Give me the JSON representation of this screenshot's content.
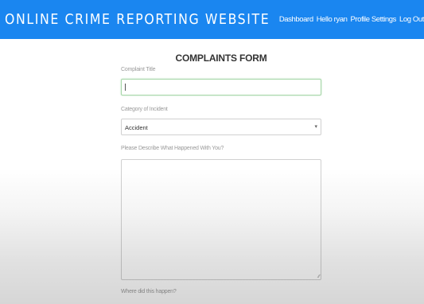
{
  "navbar": {
    "brand": "ONLINE CRIME REPORTING WEBSITE",
    "links": [
      "Dashboard",
      "Hello ryan",
      "Profile Settings",
      "Log Out"
    ],
    "background_color": "#1a86f0"
  },
  "form": {
    "title": "COMPLAINTS FORM",
    "complaint_title_label": "Complaint Title",
    "complaint_title_value": "",
    "category_label": "Category of Incident",
    "category_value": "Accident",
    "description_label": "Please Describe What Happened With You?",
    "description_value": "",
    "location_label": "Where did this happen?",
    "focus_color": "#a5d6a7"
  }
}
